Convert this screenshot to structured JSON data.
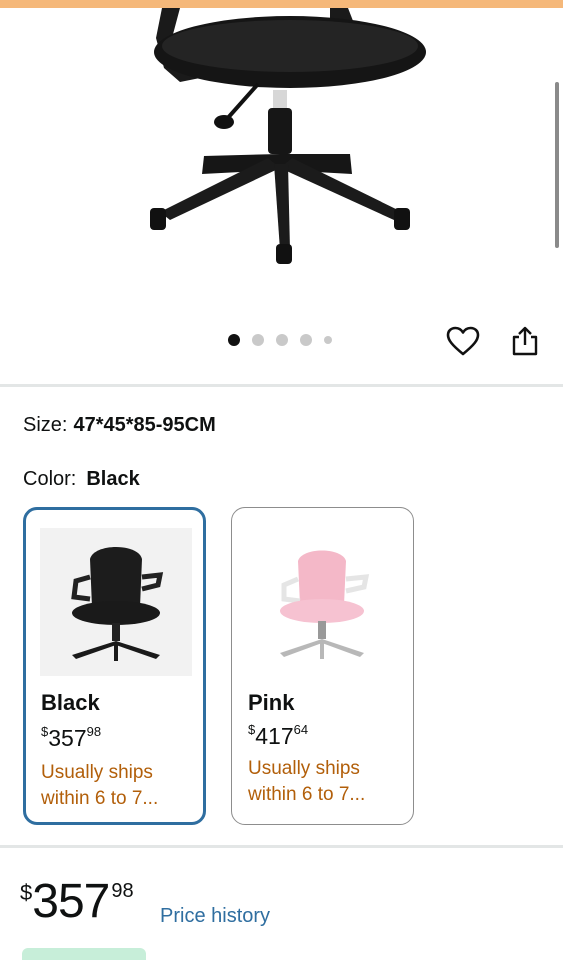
{
  "product": {
    "size_label": "Size:",
    "size_value": "47*45*85-95CM",
    "color_label": "Color:",
    "color_value": "Black",
    "carousel": {
      "count": 5,
      "active_index": 0
    }
  },
  "variants": [
    {
      "name": "Black",
      "price_symbol": "$",
      "price_whole": "357",
      "price_fraction": "98",
      "shipping": "Usually ships within 6 to 7...",
      "selected": true
    },
    {
      "name": "Pink",
      "price_symbol": "$",
      "price_whole": "417",
      "price_fraction": "64",
      "shipping": "Usually ships within 6 to 7...",
      "selected": false
    }
  ],
  "price": {
    "symbol": "$",
    "whole": "357",
    "fraction": "98",
    "history_link": "Price history"
  },
  "colors": {
    "accent_link": "#2f6ea0",
    "shipping_text": "#b25f0a",
    "selected_border": "#2f6ea0",
    "top_strip": "#f5b87a"
  },
  "icons": [
    "heart-icon",
    "share-icon"
  ]
}
